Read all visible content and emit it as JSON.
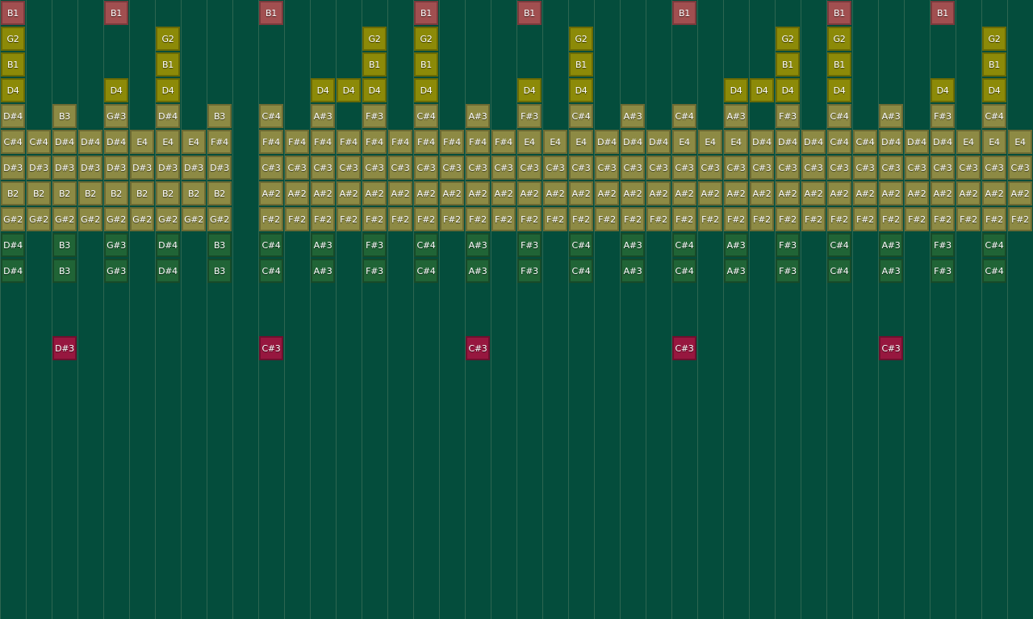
{
  "colors": {
    "background": "#044d3c",
    "red": "#a14f50",
    "gold": "#8c8a08",
    "olive": "#8d8a44",
    "green": "#206436",
    "crimson": "#97173f"
  },
  "rows": [
    {
      "color": "red",
      "cells": [
        "B1",
        "",
        "",
        "",
        "B1",
        "",
        "",
        "",
        "",
        "",
        "B1",
        "",
        "",
        "",
        "",
        "",
        "B1",
        "",
        "",
        "",
        "B1",
        "",
        "",
        "",
        "",
        "",
        "B1",
        "",
        "",
        "",
        "",
        "",
        "B1",
        "",
        "",
        "",
        "B1",
        "",
        "",
        ""
      ]
    },
    {
      "color": "gold",
      "cells": [
        "G2",
        "",
        "",
        "",
        "",
        "",
        "G2",
        "",
        "",
        "",
        "",
        "",
        "",
        "",
        "G2",
        "",
        "G2",
        "",
        "",
        "",
        "",
        "",
        "G2",
        "",
        "",
        "",
        "",
        "",
        "",
        "",
        "G2",
        "",
        "G2",
        "",
        "",
        "",
        "",
        "",
        "G2",
        ""
      ]
    },
    {
      "color": "gold",
      "cells": [
        "B1",
        "",
        "",
        "",
        "",
        "",
        "B1",
        "",
        "",
        "",
        "",
        "",
        "",
        "",
        "B1",
        "",
        "B1",
        "",
        "",
        "",
        "",
        "",
        "B1",
        "",
        "",
        "",
        "",
        "",
        "",
        "",
        "B1",
        "",
        "B1",
        "",
        "",
        "",
        "",
        "",
        "B1",
        ""
      ]
    },
    {
      "color": "gold",
      "cells": [
        "D4",
        "",
        "",
        "",
        "D4",
        "",
        "D4",
        "",
        "",
        "",
        "",
        "",
        "D4",
        "D4",
        "D4",
        "",
        "D4",
        "",
        "",
        "",
        "D4",
        "",
        "D4",
        "",
        "",
        "",
        "",
        "",
        "D4",
        "D4",
        "D4",
        "",
        "D4",
        "",
        "",
        "",
        "D4",
        "",
        "D4",
        ""
      ]
    },
    {
      "color": "olive",
      "cells": [
        "D#4",
        "",
        "B3",
        "",
        "G#3",
        "",
        "D#4",
        "",
        "B3",
        "",
        "C#4",
        "",
        "A#3",
        "",
        "F#3",
        "",
        "C#4",
        "",
        "A#3",
        "",
        "F#3",
        "",
        "C#4",
        "",
        "A#3",
        "",
        "C#4",
        "",
        "A#3",
        "",
        "F#3",
        "",
        "C#4",
        "",
        "A#3",
        "",
        "F#3",
        "",
        "C#4",
        ""
      ]
    },
    {
      "color": "olive",
      "cells": [
        "C#4",
        "C#4",
        "D#4",
        "D#4",
        "D#4",
        "E4",
        "E4",
        "E4",
        "F#4",
        "",
        "F#4",
        "F#4",
        "F#4",
        "F#4",
        "F#4",
        "F#4",
        "F#4",
        "F#4",
        "F#4",
        "F#4",
        "E4",
        "E4",
        "E4",
        "D#4",
        "D#4",
        "D#4",
        "E4",
        "E4",
        "E4",
        "D#4",
        "D#4",
        "D#4",
        "C#4",
        "C#4",
        "D#4",
        "D#4",
        "D#4",
        "E4",
        "E4",
        "E4"
      ]
    },
    {
      "color": "olive",
      "cells": [
        "D#3",
        "D#3",
        "D#3",
        "D#3",
        "D#3",
        "D#3",
        "D#3",
        "D#3",
        "D#3",
        "",
        "C#3",
        "C#3",
        "C#3",
        "C#3",
        "C#3",
        "C#3",
        "C#3",
        "C#3",
        "C#3",
        "C#3",
        "C#3",
        "C#3",
        "C#3",
        "C#3",
        "C#3",
        "C#3",
        "C#3",
        "C#3",
        "C#3",
        "C#3",
        "C#3",
        "C#3",
        "C#3",
        "C#3",
        "C#3",
        "C#3",
        "C#3",
        "C#3",
        "C#3",
        "C#3"
      ]
    },
    {
      "color": "olive",
      "cells": [
        "B2",
        "B2",
        "B2",
        "B2",
        "B2",
        "B2",
        "B2",
        "B2",
        "B2",
        "",
        "A#2",
        "A#2",
        "A#2",
        "A#2",
        "A#2",
        "A#2",
        "A#2",
        "A#2",
        "A#2",
        "A#2",
        "A#2",
        "A#2",
        "A#2",
        "A#2",
        "A#2",
        "A#2",
        "A#2",
        "A#2",
        "A#2",
        "A#2",
        "A#2",
        "A#2",
        "A#2",
        "A#2",
        "A#2",
        "A#2",
        "A#2",
        "A#2",
        "A#2",
        "A#2"
      ]
    },
    {
      "color": "olive",
      "cells": [
        "G#2",
        "G#2",
        "G#2",
        "G#2",
        "G#2",
        "G#2",
        "G#2",
        "G#2",
        "G#2",
        "",
        "F#2",
        "F#2",
        "F#2",
        "F#2",
        "F#2",
        "F#2",
        "F#2",
        "F#2",
        "F#2",
        "F#2",
        "F#2",
        "F#2",
        "F#2",
        "F#2",
        "F#2",
        "F#2",
        "F#2",
        "F#2",
        "F#2",
        "F#2",
        "F#2",
        "F#2",
        "F#2",
        "F#2",
        "F#2",
        "F#2",
        "F#2",
        "F#2",
        "F#2",
        "F#2"
      ]
    },
    {
      "color": "green",
      "cells": [
        "D#4",
        "",
        "B3",
        "",
        "G#3",
        "",
        "D#4",
        "",
        "B3",
        "",
        "C#4",
        "",
        "A#3",
        "",
        "F#3",
        "",
        "C#4",
        "",
        "A#3",
        "",
        "F#3",
        "",
        "C#4",
        "",
        "A#3",
        "",
        "C#4",
        "",
        "A#3",
        "",
        "F#3",
        "",
        "C#4",
        "",
        "A#3",
        "",
        "F#3",
        "",
        "C#4",
        ""
      ]
    },
    {
      "color": "green",
      "cells": [
        "D#4",
        "",
        "B3",
        "",
        "G#3",
        "",
        "D#4",
        "",
        "B3",
        "",
        "C#4",
        "",
        "A#3",
        "",
        "F#3",
        "",
        "C#4",
        "",
        "A#3",
        "",
        "F#3",
        "",
        "C#4",
        "",
        "A#3",
        "",
        "C#4",
        "",
        "A#3",
        "",
        "F#3",
        "",
        "C#4",
        "",
        "A#3",
        "",
        "F#3",
        "",
        "C#4",
        ""
      ]
    },
    {
      "color": "none",
      "cells": []
    },
    {
      "color": "none",
      "cells": []
    },
    {
      "color": "crimson",
      "cells": [
        "",
        "",
        "D#3",
        "",
        "",
        "",
        "",
        "",
        "",
        "",
        "C#3",
        "",
        "",
        "",
        "",
        "",
        "",
        "",
        "C#3",
        "",
        "",
        "",
        "",
        "",
        "",
        "",
        "C#3",
        "",
        "",
        "",
        "",
        "",
        "",
        "",
        "C#3",
        "",
        "",
        "",
        "",
        ""
      ]
    }
  ]
}
